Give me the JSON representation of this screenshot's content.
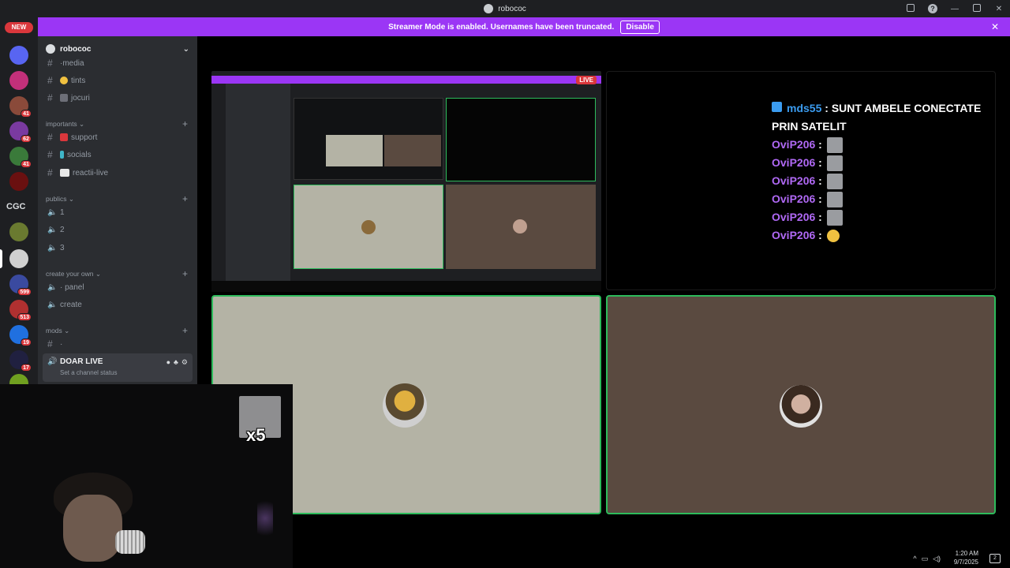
{
  "window": {
    "title": "robococ"
  },
  "banner": {
    "text": "Streamer Mode is enabled. Usernames have been truncated.",
    "button": "Disable",
    "color": "#9b36f5"
  },
  "guilds": {
    "new_badge": "NEW",
    "text_guild": "CGC",
    "badges": [
      "41",
      "62",
      "41",
      "599",
      "513",
      "19",
      "17"
    ]
  },
  "server": {
    "name": "robococ",
    "channels_top": [
      {
        "name": "media",
        "prefix": "· "
      },
      {
        "name": "tints",
        "prefix": ""
      },
      {
        "name": "jocuri",
        "prefix": ""
      }
    ],
    "categories": [
      {
        "name": "importants",
        "items": [
          "support",
          "socials",
          "reactii-live"
        ]
      },
      {
        "name": "publics",
        "items": [
          "1",
          "2",
          "3"
        ]
      },
      {
        "name": "create your own",
        "items": [
          "panel",
          "create"
        ]
      },
      {
        "name": "mods",
        "items": [
          "·"
        ]
      }
    ],
    "active_voice": {
      "name": "DOAR LIVE",
      "status": "Set a channel status"
    }
  },
  "stream": {
    "live_label": "LIVE"
  },
  "chat": [
    {
      "user": "mds55",
      "message": "SUNT AMBELE CONECTATE PRIN SATELIT"
    },
    {
      "user": "OviP206",
      "message": ""
    },
    {
      "user": "OviP206",
      "message": ""
    },
    {
      "user": "OviP206",
      "message": ""
    },
    {
      "user": "OviP206",
      "message": ""
    },
    {
      "user": "OviP206",
      "message": ""
    },
    {
      "user": "OviP206",
      "message": ""
    }
  ],
  "overlay": {
    "multiplier": "x5"
  },
  "taskbar": {
    "time": "1:20 AM",
    "date": "9/7/2025"
  },
  "colors": {
    "accent_green": "#2dbb5b",
    "tile_light": "#b4b3a5",
    "tile_brown": "#5a4a40"
  }
}
